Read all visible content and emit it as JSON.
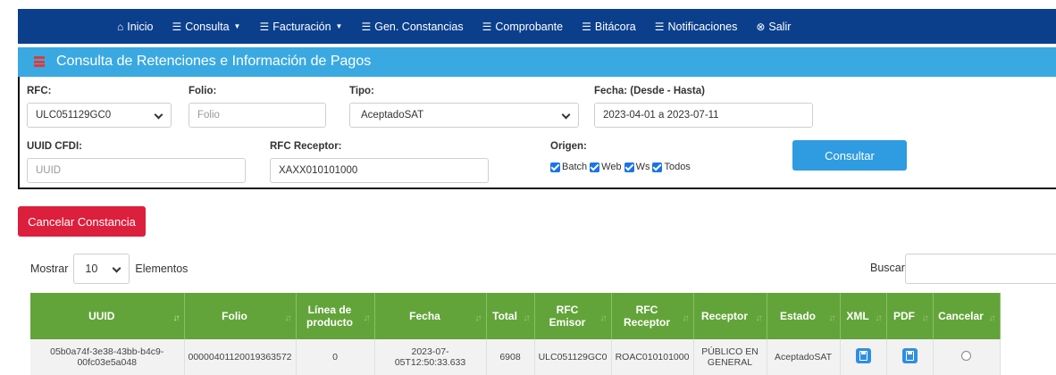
{
  "nav": {
    "items": [
      {
        "icon": "home-icon",
        "glyph": "⌂",
        "label": "Inicio",
        "caret": false
      },
      {
        "icon": "list-icon",
        "glyph": "☰",
        "label": "Consulta",
        "caret": true
      },
      {
        "icon": "list-icon",
        "glyph": "☰",
        "label": "Facturación",
        "caret": true
      },
      {
        "icon": "list-icon",
        "glyph": "☰",
        "label": "Gen. Constancias",
        "caret": false
      },
      {
        "icon": "list-icon",
        "glyph": "☰",
        "label": "Comprobante",
        "caret": false
      },
      {
        "icon": "list-icon",
        "glyph": "☰",
        "label": "Bitácora",
        "caret": false
      },
      {
        "icon": "list-icon",
        "glyph": "☰",
        "label": "Notificaciones",
        "caret": false
      },
      {
        "icon": "close-circle-icon",
        "glyph": "⊗",
        "label": "Salir",
        "caret": false
      }
    ]
  },
  "panel": {
    "title": "Consulta de Retenciones e Información de Pagos",
    "rfc_label": "RFC:",
    "rfc_value": "ULC051129GC0",
    "folio_label": "Folio:",
    "folio_placeholder": "Folio",
    "tipo_label": "Tipo:",
    "tipo_value": "AceptadoSAT",
    "fecha_label": "Fecha: (Desde - Hasta)",
    "fecha_value": "2023-04-01 a 2023-07-11",
    "uuid_label": "UUID CFDI:",
    "uuid_placeholder": "UUID",
    "rfc_receptor_label": "RFC Receptor:",
    "rfc_receptor_value": "XAXX010101000",
    "origen_label": "Origen:",
    "origen_options": [
      "Batch",
      "Web",
      "Ws",
      "Todos"
    ],
    "consultar_label": "Consultar"
  },
  "cancelar_constancia_label": "Cancelar Constancia",
  "length": {
    "mostrar": "Mostrar",
    "value": "10",
    "elementos": "Elementos"
  },
  "buscar_label": "Buscar:",
  "table": {
    "headers": [
      "UUID",
      "Folio",
      "Línea de producto",
      "Fecha",
      "Total",
      "RFC Emisor",
      "RFC Receptor",
      "Receptor",
      "Estado",
      "XML",
      "PDF",
      "Cancelar"
    ],
    "rows": [
      {
        "uuid": "05b0a74f-3e38-43bb-b4c9-00fc03e5a048",
        "folio": "00000401120019363572",
        "linea": "0",
        "fecha": "2023-07-05T12:50:33.633",
        "total": "6908",
        "rfc_emisor": "ULC051129GC0",
        "rfc_receptor": "ROAC010101000",
        "receptor": "PÚBLICO EN GENERAL",
        "estado": "AceptadoSAT"
      }
    ]
  }
}
